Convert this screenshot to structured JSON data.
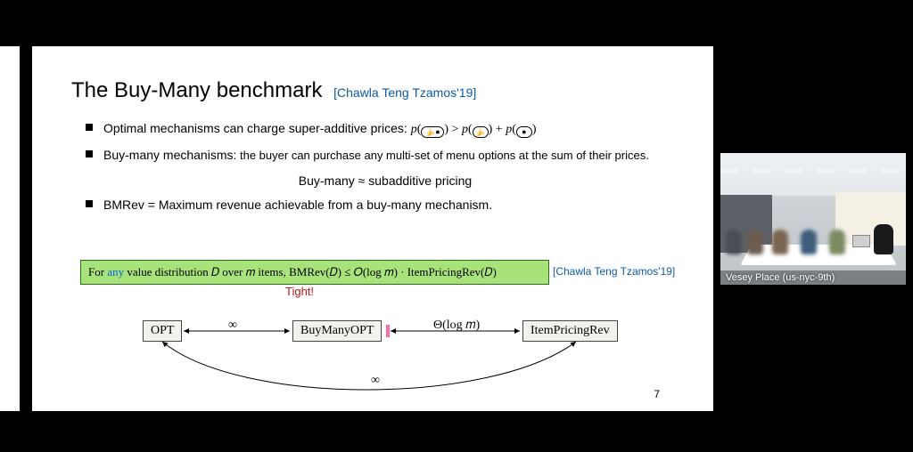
{
  "slide": {
    "title": "The Buy-Many benchmark",
    "title_cite": "[Chawla Teng Tzamos'19]",
    "bullets": {
      "b1_text": "Optimal mechanisms can charge super-additive prices:",
      "b1_math_p": "p",
      "b1_gt": ">",
      "b1_plus": "+",
      "b2_lead": "Buy-many mechanisms:",
      "b2_rest": " the buyer can purchase any multi-set of menu options at the sum of their prices.",
      "b2_center": "Buy-many ≈ subadditive pricing",
      "b3_text": "BMRev = Maximum revenue achievable from a buy-many mechanism."
    },
    "theorem": {
      "for": "For ",
      "any": "any",
      "rest": " value distribution 𝐷 over 𝑚 items, BMRev(𝐷) ≤ 𝑂(log 𝑚) · ItemPricingRev(𝐷)",
      "cite": "[Chawla Teng Tzamos'19]",
      "tight": "Tight!"
    },
    "diagram": {
      "node1": "OPT",
      "node2": "BuyManyOPT",
      "node3": "ItemPricingRev",
      "edge12": "∞",
      "edge23": "Θ(log 𝑚)",
      "edge13": "∞"
    },
    "page": "7"
  },
  "meeting": {
    "room_label": "Vesey Place (us-nyc-9th)"
  },
  "icons": {
    "banana": "🍌",
    "black_circle": "●"
  }
}
